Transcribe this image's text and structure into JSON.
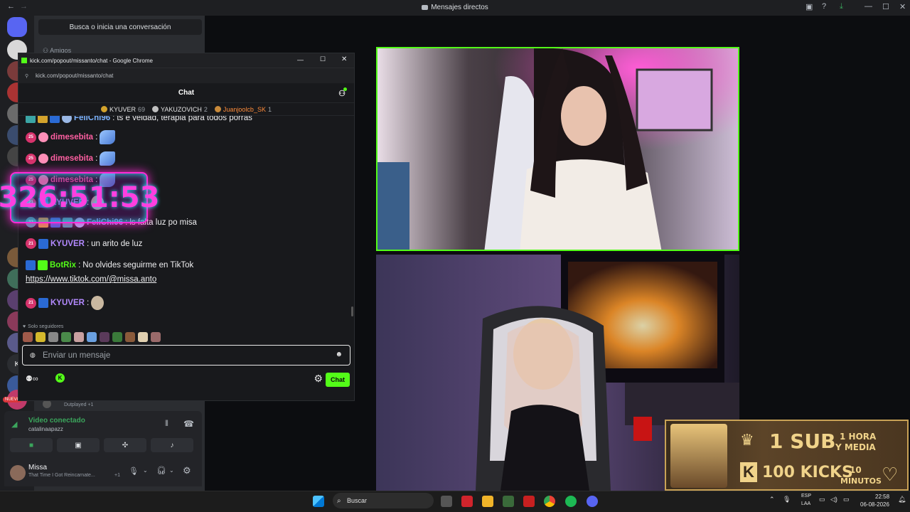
{
  "discord": {
    "window_title": "Mensajes directos",
    "search_placeholder": "Busca o inicia una conversación",
    "friends_label": "Amigos",
    "new_badge": "NUEVO",
    "voice": {
      "status": "Video conectado",
      "channel": "catalinaapazz",
      "other_user": "Dutplayed +1"
    },
    "user": {
      "name": "Missa",
      "activity": "That Time I Got Reincarnate...",
      "activity_count": "+1"
    }
  },
  "chrome": {
    "title": "kick.com/popout/missanto/chat - Google Chrome",
    "url": "kick.com/popout/missanto/chat"
  },
  "chat": {
    "header": "Chat",
    "leaderboard": [
      {
        "name": "KYUVER",
        "count": "69",
        "color": "#d4a32c"
      },
      {
        "name": "YAKUZOVICH",
        "count": "2",
        "color": "#c0c0c0"
      },
      {
        "name": "Juanjoolcb_SK",
        "count": "1",
        "color": "#c98a3a"
      }
    ],
    "messages": [
      {
        "badge": "",
        "user": "FeliChi96",
        "color": "#7db4ff",
        "text": "ts e veldad, terapia para todos porras"
      },
      {
        "badge": "25",
        "user": "dimesebita",
        "color": "#ff5fa2",
        "text": ""
      },
      {
        "badge": "25",
        "user": "dimesebita",
        "color": "#ff5fa2",
        "text": ""
      },
      {
        "badge": "25",
        "user": "dimesebita",
        "color": "#ff5fa2",
        "text": ""
      },
      {
        "badge": "21",
        "user": "KYUVER",
        "color": "#b38aff",
        "text": ""
      },
      {
        "badge": "33",
        "user": "FeliChi96",
        "color": "#7db4ff",
        "text": "ls falta luz po misa"
      },
      {
        "badge": "21",
        "user": "KYUVER",
        "color": "#b38aff",
        "text": "un arito de luz"
      },
      {
        "badge": "",
        "user": "BotRix",
        "color": "#53fc18",
        "text": "No olvides seguirme en TikTok"
      },
      {
        "badge": "21",
        "user": "KYUVER",
        "color": "#b38aff",
        "text": ""
      }
    ],
    "link": "https://www.tiktok.com/@missa.anto",
    "timer": "326:51:53",
    "followers_only": "Solo seguidores",
    "input_placeholder": "Enviar un mensaje",
    "send_button": "Chat",
    "accent": "#53fc18"
  },
  "banner": {
    "sub": "1 SUB",
    "hours": "1 HORA",
    "hours2": "Y MEDIA",
    "kicks": "100 KICKS",
    "minutes_num": "10",
    "minutes_label": "MINUTOS"
  },
  "taskbar": {
    "search": "Buscar",
    "lang": "ESP",
    "lang2": "LAA",
    "time": "22:58",
    "date": "06-08-2026"
  }
}
